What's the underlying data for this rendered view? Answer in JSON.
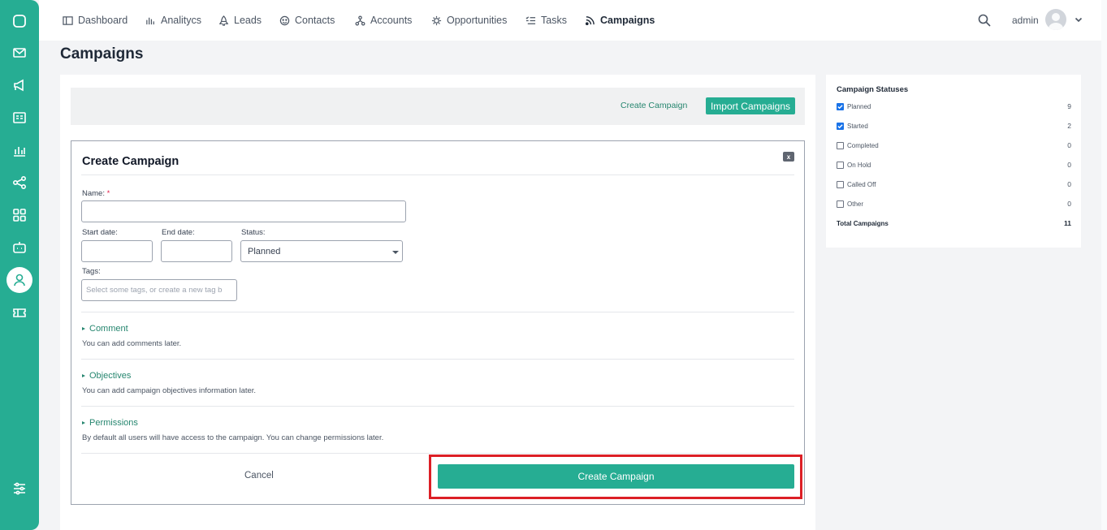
{
  "nav": {
    "items": [
      {
        "label": "Dashboard",
        "icon": "dashboard-icon"
      },
      {
        "label": "Analitycs",
        "icon": "analytics-icon"
      },
      {
        "label": "Leads",
        "icon": "leads-icon"
      },
      {
        "label": "Contacts",
        "icon": "contacts-icon"
      },
      {
        "label": "Accounts",
        "icon": "accounts-icon"
      },
      {
        "label": "Opportunities",
        "icon": "opportunities-icon"
      },
      {
        "label": "Tasks",
        "icon": "tasks-icon"
      },
      {
        "label": "Campaigns",
        "icon": "campaigns-icon",
        "active": true
      }
    ],
    "user": "admin"
  },
  "sidebar": {
    "icons": [
      "chat-icon",
      "mail-icon",
      "megaphone-icon",
      "id-card-icon",
      "chart-icon",
      "share-icon",
      "apps-grid-icon",
      "robot-icon",
      "user-icon",
      "ticket-icon",
      "settings-sliders-icon"
    ],
    "active": "user-icon"
  },
  "page": {
    "title": "Campaigns"
  },
  "toolbar": {
    "create_link": "Create Campaign",
    "import_button": "Import Campaigns"
  },
  "form": {
    "title": "Create Campaign",
    "close_label": "x",
    "name_label": "Name:",
    "name_required": "*",
    "name_value": "",
    "start_label": "Start date:",
    "end_label": "End date:",
    "status_label": "Status:",
    "status_value": "Planned",
    "tags_label": "Tags:",
    "tags_placeholder": "Select some tags, or create a new tag b",
    "sections": [
      {
        "title": "Comment",
        "desc": "You can add comments later."
      },
      {
        "title": "Objectives",
        "desc": "You can add campaign objectives information later."
      },
      {
        "title": "Permissions",
        "desc": "By default all users will have access to the campaign. You can change permissions later."
      }
    ],
    "cancel_label": "Cancel",
    "submit_label": "Create Campaign"
  },
  "statuses": {
    "title": "Campaign Statuses",
    "rows": [
      {
        "label": "Planned",
        "count": "9",
        "checked": true
      },
      {
        "label": "Started",
        "count": "2",
        "checked": true
      },
      {
        "label": "Completed",
        "count": "0",
        "checked": false
      },
      {
        "label": "On Hold",
        "count": "0",
        "checked": false
      },
      {
        "label": "Called Off",
        "count": "0",
        "checked": false
      },
      {
        "label": "Other",
        "count": "0",
        "checked": false
      }
    ],
    "total_label": "Total Campaigns",
    "total_count": "11"
  },
  "colors": {
    "accent": "#26ad93",
    "highlight": "#dc1f26",
    "link": "#26866f"
  }
}
